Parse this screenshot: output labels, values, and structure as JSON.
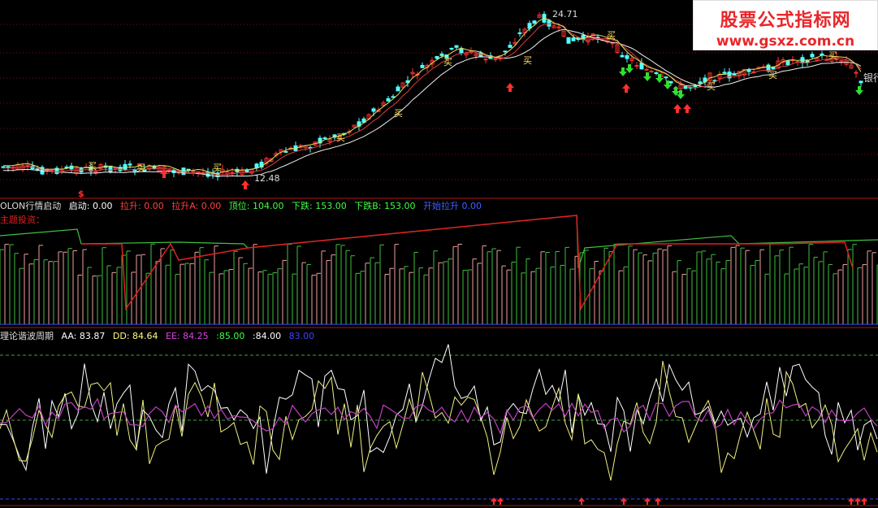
{
  "colors": {
    "background": "#000000",
    "separator": "#b01818",
    "grid": "#7a1010",
    "up_candle": "#ff3030",
    "down_candle": "#54ffff",
    "ma_white": "#f0f0f0",
    "ma_red": "#d84040",
    "ma_yellow": "#e0e060",
    "panel2_green": "#40c040",
    "panel2_red": "#e02020",
    "panel2_pink": "#f0a0a0",
    "panel2_blue": "#3050ff",
    "osc_white": "#ffffff",
    "osc_yellow": "#f0f080",
    "osc_purple": "#c040c0"
  },
  "watermark": {
    "title": "股票公式指标网",
    "url": "www.gsxz.com.cn"
  },
  "main_chart": {
    "price_high_label": "24.71",
    "price_low_label": "12.48",
    "buy_marker_text": "买",
    "right_edge_text": "银行",
    "dollar_marker": "$"
  },
  "panel2": {
    "title": "OLON行情启动",
    "fields": [
      {
        "label": "启动:",
        "value": "0.00",
        "color": "#ffffff"
      },
      {
        "label": "拉升:",
        "value": "0.00",
        "color": "#ff4040"
      },
      {
        "label": "拉升A:",
        "value": "0.00",
        "color": "#ff4040"
      },
      {
        "label": "顶位:",
        "value": "104.00",
        "color": "#40ff40"
      },
      {
        "label": "下跌:",
        "value": "153.00",
        "color": "#40ff40"
      },
      {
        "label": "下跌B:",
        "value": "153.00",
        "color": "#40ff40"
      },
      {
        "label": "开始拉升",
        "value": "0.00",
        "color": "#4060ff"
      }
    ],
    "subtitle": "主题投资："
  },
  "panel3": {
    "title": "理论谐波周期",
    "fields": [
      {
        "label": "AA:",
        "value": "83.87",
        "color": "#ffffff"
      },
      {
        "label": "DD:",
        "value": "84.64",
        "color": "#ffff80"
      },
      {
        "label": "EE:",
        "value": "84.25",
        "color": "#e040e0"
      },
      {
        "label": ":",
        "value": "85.00",
        "color": "#40ff40"
      },
      {
        "label": ":",
        "value": "84.00",
        "color": "#ffffff"
      },
      {
        "label": "",
        "value": "83.00",
        "color": "#4040ff"
      }
    ]
  }
}
